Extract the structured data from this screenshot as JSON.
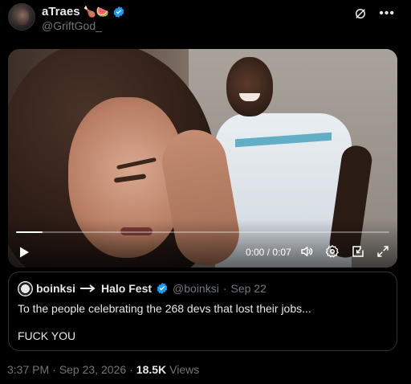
{
  "author": {
    "display_name": "aTraes",
    "emoji": "🍗🍉",
    "handle": "@GriftGod_",
    "verified": true
  },
  "header_actions": [
    "grok-icon",
    "more-icon"
  ],
  "video": {
    "current_time": "0:00",
    "separator": "/",
    "duration": "0:07",
    "progress": 0.07,
    "controls": [
      "play-icon",
      "volume-icon",
      "settings-icon",
      "fullscreen-exit-icon",
      "expand-icon"
    ]
  },
  "quote": {
    "name": "boinksi",
    "badge_icon": "soon-arrow-icon",
    "game": "Halo Fest",
    "verified": true,
    "handle": "@boinksi",
    "dot": "·",
    "date": "Sep 22",
    "line1": "To the people celebrating the 268 devs that lost their jobs...",
    "line2": "FUCK YOU"
  },
  "footer": {
    "time": "3:37 PM",
    "dot1": "·",
    "date": "Sep 23, 2026",
    "dot2": "·",
    "views_count": "18.5K",
    "views_label": "Views"
  },
  "colors": {
    "background": "#000000",
    "text": "#e7e9ea",
    "muted": "#71767b",
    "verified": "#1d9bf0",
    "border": "#2f3336"
  }
}
